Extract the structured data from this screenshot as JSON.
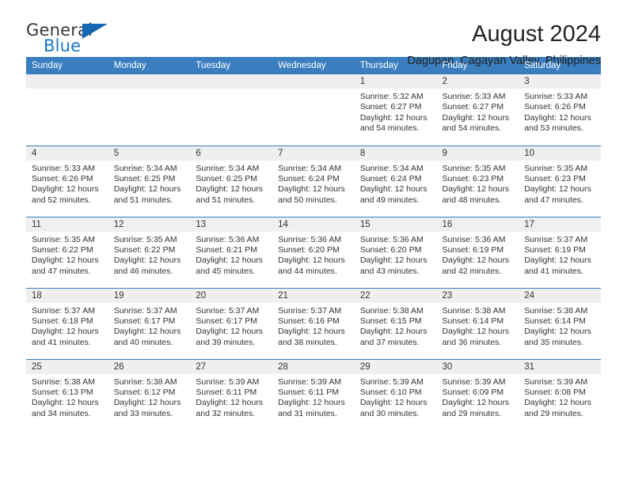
{
  "brand": {
    "name_top": "General",
    "name_bottom": "Blue",
    "triangle_icon": "blue-triangle-icon",
    "color_top": "#363636",
    "color_bottom": "#1b76c3"
  },
  "header": {
    "month_title": "August 2024",
    "location": "Dagupan, Cagayan Valley, Philippines"
  },
  "theme": {
    "header_bar": "#3a7ebf",
    "daynum_band": "#efefef",
    "text": "#333333"
  },
  "weekday_headers": [
    "Sunday",
    "Monday",
    "Tuesday",
    "Wednesday",
    "Thursday",
    "Friday",
    "Saturday"
  ],
  "weeks": [
    [
      {
        "day": "",
        "lines": []
      },
      {
        "day": "",
        "lines": []
      },
      {
        "day": "",
        "lines": []
      },
      {
        "day": "",
        "lines": []
      },
      {
        "day": "1",
        "lines": [
          "Sunrise: 5:32 AM",
          "Sunset: 6:27 PM",
          "Daylight: 12 hours",
          "and 54 minutes."
        ]
      },
      {
        "day": "2",
        "lines": [
          "Sunrise: 5:33 AM",
          "Sunset: 6:27 PM",
          "Daylight: 12 hours",
          "and 54 minutes."
        ]
      },
      {
        "day": "3",
        "lines": [
          "Sunrise: 5:33 AM",
          "Sunset: 6:26 PM",
          "Daylight: 12 hours",
          "and 53 minutes."
        ]
      }
    ],
    [
      {
        "day": "4",
        "lines": [
          "Sunrise: 5:33 AM",
          "Sunset: 6:26 PM",
          "Daylight: 12 hours",
          "and 52 minutes."
        ]
      },
      {
        "day": "5",
        "lines": [
          "Sunrise: 5:34 AM",
          "Sunset: 6:25 PM",
          "Daylight: 12 hours",
          "and 51 minutes."
        ]
      },
      {
        "day": "6",
        "lines": [
          "Sunrise: 5:34 AM",
          "Sunset: 6:25 PM",
          "Daylight: 12 hours",
          "and 51 minutes."
        ]
      },
      {
        "day": "7",
        "lines": [
          "Sunrise: 5:34 AM",
          "Sunset: 6:24 PM",
          "Daylight: 12 hours",
          "and 50 minutes."
        ]
      },
      {
        "day": "8",
        "lines": [
          "Sunrise: 5:34 AM",
          "Sunset: 6:24 PM",
          "Daylight: 12 hours",
          "and 49 minutes."
        ]
      },
      {
        "day": "9",
        "lines": [
          "Sunrise: 5:35 AM",
          "Sunset: 6:23 PM",
          "Daylight: 12 hours",
          "and 48 minutes."
        ]
      },
      {
        "day": "10",
        "lines": [
          "Sunrise: 5:35 AM",
          "Sunset: 6:23 PM",
          "Daylight: 12 hours",
          "and 47 minutes."
        ]
      }
    ],
    [
      {
        "day": "11",
        "lines": [
          "Sunrise: 5:35 AM",
          "Sunset: 6:22 PM",
          "Daylight: 12 hours",
          "and 47 minutes."
        ]
      },
      {
        "day": "12",
        "lines": [
          "Sunrise: 5:35 AM",
          "Sunset: 6:22 PM",
          "Daylight: 12 hours",
          "and 46 minutes."
        ]
      },
      {
        "day": "13",
        "lines": [
          "Sunrise: 5:36 AM",
          "Sunset: 6:21 PM",
          "Daylight: 12 hours",
          "and 45 minutes."
        ]
      },
      {
        "day": "14",
        "lines": [
          "Sunrise: 5:36 AM",
          "Sunset: 6:20 PM",
          "Daylight: 12 hours",
          "and 44 minutes."
        ]
      },
      {
        "day": "15",
        "lines": [
          "Sunrise: 5:36 AM",
          "Sunset: 6:20 PM",
          "Daylight: 12 hours",
          "and 43 minutes."
        ]
      },
      {
        "day": "16",
        "lines": [
          "Sunrise: 5:36 AM",
          "Sunset: 6:19 PM",
          "Daylight: 12 hours",
          "and 42 minutes."
        ]
      },
      {
        "day": "17",
        "lines": [
          "Sunrise: 5:37 AM",
          "Sunset: 6:19 PM",
          "Daylight: 12 hours",
          "and 41 minutes."
        ]
      }
    ],
    [
      {
        "day": "18",
        "lines": [
          "Sunrise: 5:37 AM",
          "Sunset: 6:18 PM",
          "Daylight: 12 hours",
          "and 41 minutes."
        ]
      },
      {
        "day": "19",
        "lines": [
          "Sunrise: 5:37 AM",
          "Sunset: 6:17 PM",
          "Daylight: 12 hours",
          "and 40 minutes."
        ]
      },
      {
        "day": "20",
        "lines": [
          "Sunrise: 5:37 AM",
          "Sunset: 6:17 PM",
          "Daylight: 12 hours",
          "and 39 minutes."
        ]
      },
      {
        "day": "21",
        "lines": [
          "Sunrise: 5:37 AM",
          "Sunset: 6:16 PM",
          "Daylight: 12 hours",
          "and 38 minutes."
        ]
      },
      {
        "day": "22",
        "lines": [
          "Sunrise: 5:38 AM",
          "Sunset: 6:15 PM",
          "Daylight: 12 hours",
          "and 37 minutes."
        ]
      },
      {
        "day": "23",
        "lines": [
          "Sunrise: 5:38 AM",
          "Sunset: 6:14 PM",
          "Daylight: 12 hours",
          "and 36 minutes."
        ]
      },
      {
        "day": "24",
        "lines": [
          "Sunrise: 5:38 AM",
          "Sunset: 6:14 PM",
          "Daylight: 12 hours",
          "and 35 minutes."
        ]
      }
    ],
    [
      {
        "day": "25",
        "lines": [
          "Sunrise: 5:38 AM",
          "Sunset: 6:13 PM",
          "Daylight: 12 hours",
          "and 34 minutes."
        ]
      },
      {
        "day": "26",
        "lines": [
          "Sunrise: 5:38 AM",
          "Sunset: 6:12 PM",
          "Daylight: 12 hours",
          "and 33 minutes."
        ]
      },
      {
        "day": "27",
        "lines": [
          "Sunrise: 5:39 AM",
          "Sunset: 6:11 PM",
          "Daylight: 12 hours",
          "and 32 minutes."
        ]
      },
      {
        "day": "28",
        "lines": [
          "Sunrise: 5:39 AM",
          "Sunset: 6:11 PM",
          "Daylight: 12 hours",
          "and 31 minutes."
        ]
      },
      {
        "day": "29",
        "lines": [
          "Sunrise: 5:39 AM",
          "Sunset: 6:10 PM",
          "Daylight: 12 hours",
          "and 30 minutes."
        ]
      },
      {
        "day": "30",
        "lines": [
          "Sunrise: 5:39 AM",
          "Sunset: 6:09 PM",
          "Daylight: 12 hours",
          "and 29 minutes."
        ]
      },
      {
        "day": "31",
        "lines": [
          "Sunrise: 5:39 AM",
          "Sunset: 6:08 PM",
          "Daylight: 12 hours",
          "and 29 minutes."
        ]
      }
    ]
  ]
}
